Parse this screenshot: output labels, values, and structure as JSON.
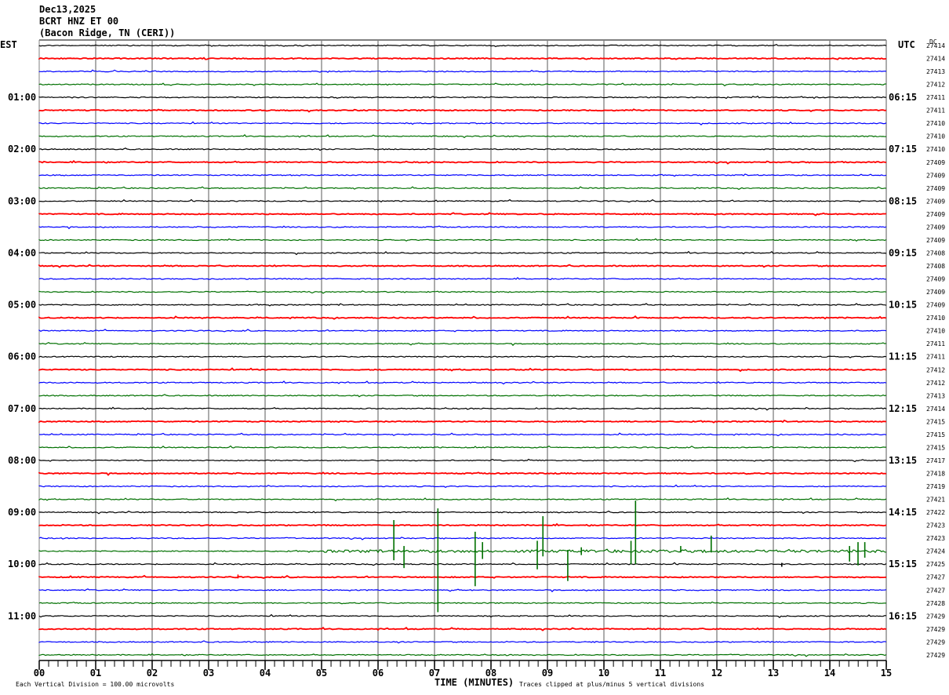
{
  "header": {
    "date": "Dec13,2025",
    "channel": "BCRT HNZ ET 00",
    "location": "(Bacon Ridge, TN (CERI))"
  },
  "chart_data": {
    "type": "line",
    "left_timezone": "EST",
    "right_timezone": "UTC",
    "dc_header": "DC",
    "xlabel": "TIME (MINUTES)",
    "xlim": [
      0,
      15
    ],
    "x_ticks": [
      "00",
      "01",
      "02",
      "03",
      "04",
      "05",
      "06",
      "07",
      "08",
      "09",
      "10",
      "11",
      "12",
      "13",
      "14",
      "15"
    ],
    "minor_tick_interval_minutes": 0.1667,
    "grid": true,
    "minutes_per_line": 15,
    "trace_colors": [
      "#000000",
      "#ff0000",
      "#0000ff",
      "#007000"
    ],
    "left_hour_labels": [
      "",
      "01:00",
      "02:00",
      "03:00",
      "04:00",
      "05:00",
      "06:00",
      "07:00",
      "08:00",
      "09:00",
      "10:00",
      "11:00"
    ],
    "right_hour_labels": [
      "",
      "06:15",
      "07:15",
      "08:15",
      "09:15",
      "10:15",
      "11:15",
      "12:15",
      "13:15",
      "14:15",
      "15:15",
      "16:15"
    ],
    "dc_values": [
      27414,
      27414,
      27413,
      27412,
      27411,
      27411,
      27410,
      27410,
      27410,
      27409,
      27409,
      27409,
      27409,
      27409,
      27409,
      27409,
      27408,
      27408,
      27409,
      27409,
      27409,
      27410,
      27410,
      27411,
      27411,
      27412,
      27412,
      27413,
      27414,
      27415,
      27415,
      27415,
      27417,
      27418,
      27419,
      27421,
      27422,
      27423,
      27423,
      27424,
      27425,
      27427,
      27427,
      27428,
      27429,
      27429,
      27429,
      27429
    ],
    "events": [
      {
        "line": 39,
        "minute": 6.28,
        "up_uv": 240,
        "down_uv": 70
      },
      {
        "line": 39,
        "minute": 6.46,
        "up_uv": 40,
        "down_uv": 130
      },
      {
        "line": 39,
        "minute": 7.06,
        "up_uv": 330,
        "down_uv": 470
      },
      {
        "line": 39,
        "minute": 7.72,
        "up_uv": 150,
        "down_uv": 270
      },
      {
        "line": 39,
        "minute": 7.85,
        "up_uv": 70,
        "down_uv": 60
      },
      {
        "line": 39,
        "minute": 8.82,
        "up_uv": 80,
        "down_uv": 140
      },
      {
        "line": 39,
        "minute": 8.92,
        "up_uv": 270,
        "down_uv": 40
      },
      {
        "line": 39,
        "minute": 9.36,
        "up_uv": 10,
        "down_uv": 230
      },
      {
        "line": 39,
        "minute": 9.6,
        "up_uv": 30,
        "down_uv": 30
      },
      {
        "line": 39,
        "minute": 10.48,
        "up_uv": 80,
        "down_uv": 100
      },
      {
        "line": 39,
        "minute": 10.56,
        "up_uv": 390,
        "down_uv": 100
      },
      {
        "line": 39,
        "minute": 11.36,
        "up_uv": 40,
        "down_uv": 10
      },
      {
        "line": 39,
        "minute": 11.9,
        "up_uv": 120,
        "down_uv": 10
      },
      {
        "line": 39,
        "minute": 14.35,
        "up_uv": 40,
        "down_uv": 80
      },
      {
        "line": 39,
        "minute": 14.5,
        "up_uv": 70,
        "down_uv": 110
      },
      {
        "line": 39,
        "minute": 14.62,
        "up_uv": 70,
        "down_uv": 50
      },
      {
        "line": 40,
        "minute": 13.15,
        "up_uv": 10,
        "down_uv": 20
      },
      {
        "line": 41,
        "minute": 3.52,
        "up_uv": 20,
        "down_uv": 10
      }
    ],
    "footer_left": "Each Vertical Division =  100.00 microvolts",
    "footer_right": "Traces clipped at plus/minus 5 vertical divisions"
  }
}
